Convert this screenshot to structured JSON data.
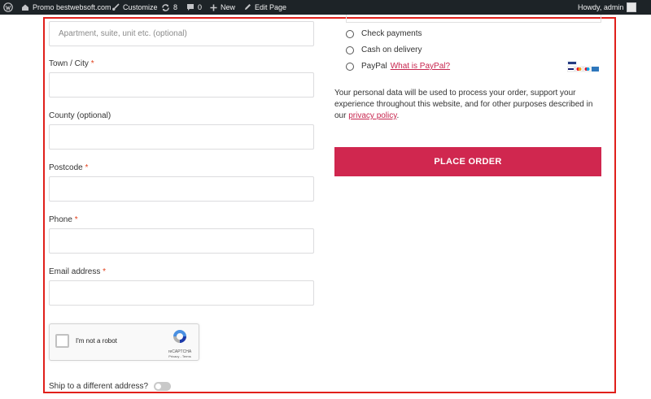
{
  "adminbar": {
    "site_name": "Promo bestwebsoft.com",
    "customize": "Customize",
    "updates_count": "8",
    "comments_count": "0",
    "new_label": "New",
    "edit_page": "Edit Page",
    "howdy": "Howdy, admin"
  },
  "form": {
    "address2_placeholder": "Apartment, suite, unit etc. (optional)",
    "town_label": "Town / City",
    "county_label": "County (optional)",
    "postcode_label": "Postcode",
    "phone_label": "Phone",
    "email_label": "Email address",
    "required_mark": "*",
    "recaptcha_label": "I'm not a robot",
    "recaptcha_brand": "reCAPTCHA",
    "recaptcha_links": "Privacy - Terms",
    "ship_label": "Ship to a different address?"
  },
  "payment": {
    "options": [
      "Check payments",
      "Cash on delivery",
      "PayPal"
    ],
    "paypal_link": "What is PayPal?",
    "privacy_text": "Your personal data will be used to process your order, support your experience throughout this website, and for other purposes described in our",
    "privacy_link": "privacy policy",
    "privacy_end": ".",
    "place_order": "Place order"
  },
  "colors": {
    "accent": "#d0274f",
    "highlight": "#e0201b",
    "adminbar": "#1d2327"
  }
}
